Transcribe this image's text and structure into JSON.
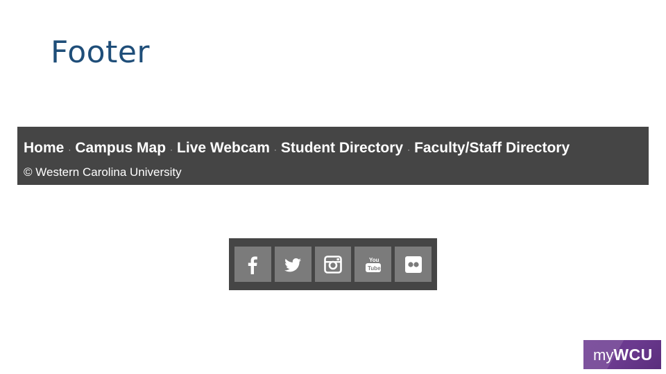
{
  "slide": {
    "title": "Footer"
  },
  "footer": {
    "links": [
      "Home",
      "Campus Map",
      "Live Webcam",
      "Student Directory",
      "Faculty/Staff Directory"
    ],
    "separator": "·",
    "copyright": "© Western Carolina University",
    "background_color": "#454545",
    "text_color": "#ffffff"
  },
  "social": {
    "icons": [
      "facebook-icon",
      "twitter-icon",
      "instagram-icon",
      "youtube-icon",
      "flickr-icon"
    ],
    "youtube_text": [
      "You",
      "Tube"
    ],
    "button_color": "#7b7b7b"
  },
  "logo": {
    "my": "my",
    "brand": "WCU",
    "color": "#6b3a8f"
  }
}
